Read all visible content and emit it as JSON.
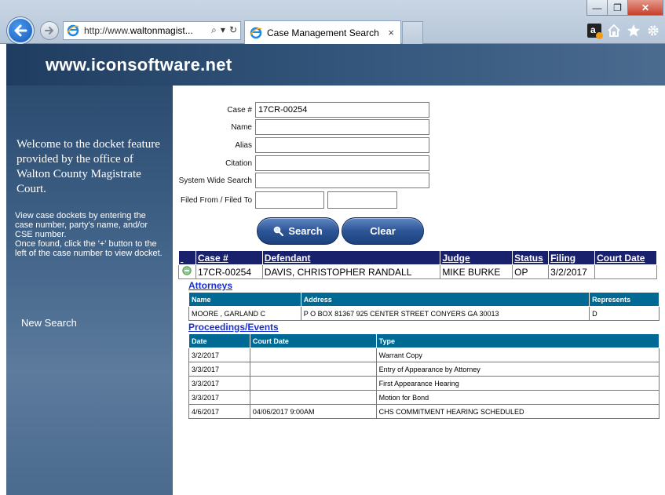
{
  "browser": {
    "url_prefix": "http://www.",
    "url_domain": "waltonmagist...",
    "tab_title": "Case Management Search",
    "close_tab": "×",
    "min": "—",
    "max": "❐",
    "close": "✕",
    "addr_search_icon": "⌕",
    "addr_dropdown": "▾",
    "addr_refresh": "↻"
  },
  "site": {
    "title": "www.iconsoftware.net"
  },
  "sidebar": {
    "welcome": "Welcome to the docket feature provided by the office of Walton County Magistrate Court.",
    "instructions_1": "View case dockets by entering the case number, party's name, and/or CSE number.",
    "instructions_2": "Once found, click the '+' button to the left of the case number to view docket.",
    "new_search": "New Search"
  },
  "form": {
    "case_label": "Case #",
    "case_value": "17CR-00254",
    "name_label": "Name",
    "alias_label": "Alias",
    "citation_label": "Citation",
    "system_label": "System Wide Search",
    "filed_label": "Filed From / Filed To",
    "search_label": "Search",
    "clear_label": "Clear"
  },
  "results": {
    "headers": [
      "Case #",
      "Defendant",
      "Judge",
      "Status",
      "Filing",
      "Court Date"
    ],
    "row": {
      "case": "17CR-00254",
      "defendant": "DAVIS, CHRISTOPHER RANDALL",
      "judge": "MIKE BURKE",
      "status": "OP",
      "filing": "3/2/2017",
      "court_date": ""
    }
  },
  "attorneys": {
    "title": "Attorneys",
    "headers": [
      "Name",
      "Address",
      "Represents"
    ],
    "rows": [
      {
        "name": "MOORE , GARLAND C",
        "address": "P O BOX 81367 925 CENTER STREET CONYERS GA 30013",
        "represents": "D"
      }
    ]
  },
  "proceedings": {
    "title": "Proceedings/Events",
    "headers": [
      "Date",
      "Court Date",
      "Type"
    ],
    "rows": [
      {
        "date": "3/2/2017",
        "court_date": "",
        "type": "Warrant Copy"
      },
      {
        "date": "3/3/2017",
        "court_date": "",
        "type": "Entry of Appearance by Attorney"
      },
      {
        "date": "3/3/2017",
        "court_date": "",
        "type": "First Appearance Hearing"
      },
      {
        "date": "3/3/2017",
        "court_date": "",
        "type": "Motion for Bond"
      },
      {
        "date": "4/6/2017",
        "court_date": "04/06/2017 9:00AM",
        "type": "CHS COMMITMENT HEARING SCHEDULED"
      }
    ]
  },
  "colors": {
    "results_header": "#19216c",
    "sub_header": "#006a94",
    "link": "#1a2fcf"
  }
}
